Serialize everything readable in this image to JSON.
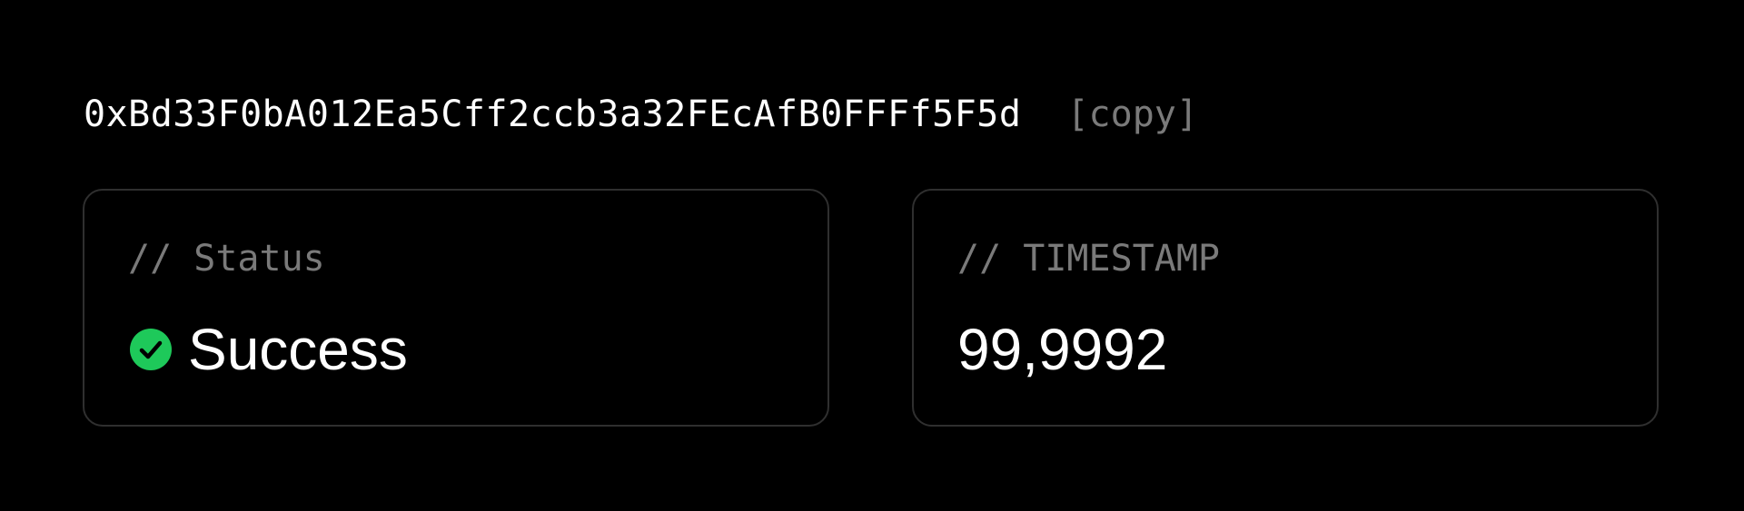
{
  "address": {
    "value": "0xBd33F0bA012Ea5Cff2ccb3a32FEcAfB0FFFf5F5d",
    "copy_label": "[copy]"
  },
  "status_card": {
    "label": "// Status",
    "value": "Success",
    "icon": "check-circle-icon",
    "icon_color": "#1ec95a"
  },
  "timestamp_card": {
    "label": "// TIMESTAMP",
    "value": "99,9992"
  },
  "colors": {
    "background": "#000000",
    "text": "#ffffff",
    "muted": "#7a7a7a",
    "border": "#2f2f2f",
    "success": "#1ec95a"
  }
}
